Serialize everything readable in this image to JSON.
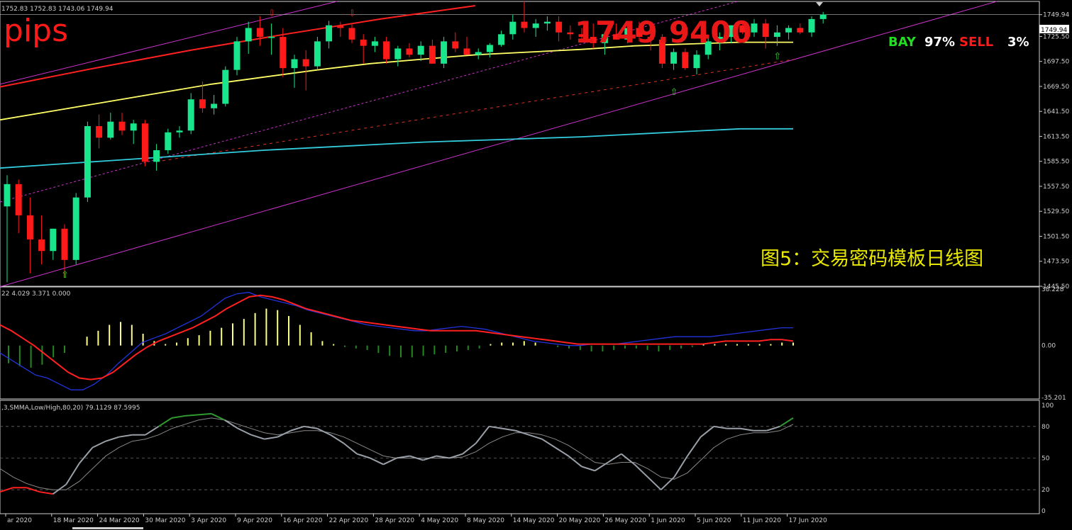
{
  "header": {
    "ohlc_text": "1752.83 1752.83 1743.06 1749.94",
    "pips_label": "pips",
    "price_big": "1749.9400",
    "bay_label": "BAY",
    "bay_pct": "97%",
    "sell_label": "SELL",
    "sell_pct": "3%",
    "caption": "图5：交易密码模板日线图",
    "current_price_tag": "1749.94"
  },
  "colors": {
    "background": "#000000",
    "bull": "#19e68c",
    "bear": "#ff1a1a",
    "ma_yellow": "#ffff66",
    "ma_cyan": "#33ccdd",
    "ma_red": "#ff2020",
    "channel": "#cc33cc",
    "macd_signal": "#ff2020",
    "macd_main": "#2233dd",
    "hist_pos": "#ffff88",
    "hist_neg": "#228822",
    "stoch_main": "#9aa0a8",
    "stoch_signal": "#888888",
    "stoch_up": "#2f9a2f",
    "stoch_down": "#ff2020"
  },
  "chart_data": [
    {
      "type": "candlestick",
      "title": "",
      "ylim": [
        1445.5,
        1760
      ],
      "y_ticks": [
        "1749.94",
        "1725.50",
        "1697.50",
        "1669.50",
        "1641.50",
        "1613.50",
        "1585.50",
        "1557.50",
        "1529.50",
        "1501.50",
        "1473.50",
        "1445.50"
      ],
      "x_labels": [
        {
          "i": 0,
          "label": "ar 2020"
        },
        {
          "i": 4,
          "label": "18 Mar 2020"
        },
        {
          "i": 8,
          "label": "24 Mar 2020"
        },
        {
          "i": 12,
          "label": "30 Mar 2020"
        },
        {
          "i": 16,
          "label": "3 Apr 2020"
        },
        {
          "i": 20,
          "label": "9 Apr 2020"
        },
        {
          "i": 24,
          "label": "16 Apr 2020"
        },
        {
          "i": 28,
          "label": "22 Apr 2020"
        },
        {
          "i": 32,
          "label": "28 Apr 2020"
        },
        {
          "i": 36,
          "label": "4 May 2020"
        },
        {
          "i": 40,
          "label": "8 May 2020"
        },
        {
          "i": 44,
          "label": "14 May 2020"
        },
        {
          "i": 48,
          "label": "20 May 2020"
        },
        {
          "i": 52,
          "label": "26 May 2020"
        },
        {
          "i": 56,
          "label": "1 Jun 2020"
        },
        {
          "i": 60,
          "label": "5 Jun 2020"
        },
        {
          "i": 64,
          "label": "11 Jun 2020"
        },
        {
          "i": 68,
          "label": "17 Jun 2020"
        }
      ],
      "candles": [
        [
          1535,
          1570,
          1450,
          1560
        ],
        [
          1560,
          1565,
          1505,
          1525
        ],
        [
          1525,
          1545,
          1460,
          1498
        ],
        [
          1498,
          1525,
          1470,
          1485
        ],
        [
          1485,
          1510,
          1475,
          1510
        ],
        [
          1510,
          1515,
          1455,
          1475
        ],
        [
          1475,
          1550,
          1470,
          1545
        ],
        [
          1545,
          1630,
          1540,
          1625
        ],
        [
          1625,
          1638,
          1600,
          1612
        ],
        [
          1612,
          1640,
          1610,
          1630
        ],
        [
          1630,
          1640,
          1615,
          1620
        ],
        [
          1620,
          1632,
          1605,
          1628
        ],
        [
          1628,
          1632,
          1580,
          1585
        ],
        [
          1585,
          1605,
          1575,
          1598
        ],
        [
          1598,
          1622,
          1594,
          1618
        ],
        [
          1618,
          1625,
          1612,
          1620
        ],
        [
          1620,
          1662,
          1616,
          1655
        ],
        [
          1655,
          1675,
          1640,
          1645
        ],
        [
          1645,
          1660,
          1638,
          1650
        ],
        [
          1650,
          1692,
          1647,
          1688
        ],
        [
          1688,
          1725,
          1682,
          1720
        ],
        [
          1720,
          1742,
          1706,
          1735
        ],
        [
          1735,
          1748,
          1715,
          1725
        ],
        [
          1725,
          1740,
          1705,
          1725
        ],
        [
          1725,
          1735,
          1680,
          1690
        ],
        [
          1690,
          1705,
          1668,
          1700
        ],
        [
          1700,
          1710,
          1665,
          1692
        ],
        [
          1692,
          1725,
          1688,
          1720
        ],
        [
          1720,
          1743,
          1712,
          1738
        ],
        [
          1738,
          1742,
          1725,
          1735
        ],
        [
          1735,
          1740,
          1718,
          1722
        ],
        [
          1722,
          1728,
          1695,
          1715
        ],
        [
          1715,
          1725,
          1708,
          1720
        ],
        [
          1720,
          1725,
          1695,
          1700
        ],
        [
          1700,
          1715,
          1692,
          1712
        ],
        [
          1712,
          1718,
          1702,
          1705
        ],
        [
          1705,
          1720,
          1698,
          1715
        ],
        [
          1715,
          1722,
          1702,
          1695
        ],
        [
          1695,
          1725,
          1690,
          1720
        ],
        [
          1720,
          1730,
          1708,
          1712
        ],
        [
          1712,
          1725,
          1705,
          1705
        ],
        [
          1705,
          1712,
          1700,
          1708
        ],
        [
          1708,
          1718,
          1702,
          1716
        ],
        [
          1716,
          1732,
          1714,
          1728
        ],
        [
          1728,
          1750,
          1722,
          1742
        ],
        [
          1742,
          1765,
          1730,
          1735
        ],
        [
          1735,
          1745,
          1725,
          1740
        ],
        [
          1740,
          1748,
          1732,
          1742
        ],
        [
          1742,
          1748,
          1720,
          1730
        ],
        [
          1730,
          1738,
          1722,
          1728
        ],
        [
          1728,
          1735,
          1720,
          1725
        ],
        [
          1725,
          1740,
          1712,
          1718
        ],
        [
          1718,
          1730,
          1705,
          1728
        ],
        [
          1728,
          1740,
          1722,
          1722
        ],
        [
          1722,
          1738,
          1718,
          1735
        ],
        [
          1735,
          1742,
          1720,
          1725
        ],
        [
          1725,
          1728,
          1710,
          1722
        ],
        [
          1722,
          1728,
          1690,
          1695
        ],
        [
          1695,
          1712,
          1688,
          1708
        ],
        [
          1708,
          1712,
          1688,
          1690
        ],
        [
          1690,
          1710,
          1683,
          1705
        ],
        [
          1705,
          1725,
          1700,
          1720
        ],
        [
          1720,
          1730,
          1710,
          1725
        ],
        [
          1725,
          1738,
          1718,
          1738
        ],
        [
          1738,
          1742,
          1728,
          1730
        ],
        [
          1730,
          1745,
          1725,
          1740
        ],
        [
          1740,
          1745,
          1712,
          1725
        ],
        [
          1725,
          1738,
          1715,
          1730
        ],
        [
          1730,
          1738,
          1722,
          1735
        ],
        [
          1735,
          1740,
          1728,
          1730
        ],
        [
          1730,
          1748,
          1725,
          1745
        ],
        [
          1745,
          1753,
          1740,
          1750
        ]
      ],
      "ma_slow_yellow": [
        1632,
        1642,
        1652,
        1662,
        1672,
        1680,
        1688,
        1695,
        1700,
        1705,
        1708,
        1711,
        1715,
        1717,
        1719,
        1719
      ],
      "ma_slow_cyan": [
        1578,
        1582,
        1586,
        1590,
        1594,
        1598,
        1601,
        1604,
        1607,
        1609,
        1611,
        1613,
        1616,
        1619,
        1622,
        1622
      ],
      "ma_slow_red_upper": [
        1669,
        1690,
        1710,
        1728,
        1745,
        1760
      ]
    },
    {
      "type": "line",
      "title": "MACD",
      "label_text": "22 4.029 3.371 0.000",
      "ylim": [
        -35.201,
        38.228
      ],
      "y_ticks": [
        "38.228",
        "0.00",
        "-35.201"
      ],
      "histogram": [
        -12,
        -14,
        -15,
        -13,
        -8,
        -5,
        0,
        6,
        10,
        14,
        16,
        14,
        8,
        3,
        1,
        2,
        5,
        7,
        10,
        12,
        15,
        18,
        22,
        25,
        24,
        20,
        14,
        9,
        3,
        1,
        -1,
        -2,
        -3,
        -5,
        -7,
        -8,
        -8,
        -7,
        -6,
        -5,
        -4,
        -3,
        -2,
        1,
        2,
        2,
        3,
        2,
        0,
        -1,
        -2,
        -3,
        -4,
        -4,
        -3,
        -2,
        -2,
        -3,
        -4,
        -3,
        -2,
        -1,
        1,
        1,
        1,
        1,
        1,
        1,
        1,
        2,
        2
      ],
      "signal": [
        14,
        10,
        5,
        0,
        -6,
        -12,
        -18,
        -22,
        -23,
        -22,
        -18,
        -12,
        -6,
        -1,
        3,
        6,
        9,
        12,
        16,
        20,
        25,
        29,
        33,
        34,
        33,
        31,
        28,
        25,
        23,
        21,
        19,
        17,
        16,
        15,
        14,
        13,
        12,
        11,
        10,
        10,
        10,
        10,
        10,
        9,
        8,
        7,
        6,
        5,
        4,
        3,
        2,
        1,
        1,
        1,
        1,
        1,
        1,
        1,
        1,
        1,
        1,
        1,
        1,
        2,
        3,
        3,
        3,
        3,
        4,
        4,
        3
      ],
      "main": [
        -5,
        -10,
        -15,
        -20,
        -22,
        -26,
        -30,
        -30,
        -26,
        -20,
        -12,
        -5,
        2,
        5,
        8,
        12,
        16,
        20,
        26,
        32,
        35,
        36,
        33,
        31,
        29,
        27,
        24,
        22,
        20,
        18,
        16,
        14,
        13,
        12,
        11,
        10,
        10,
        11,
        12,
        13,
        12,
        11,
        9,
        7,
        5,
        3,
        2,
        1,
        0,
        0,
        1,
        1,
        1,
        2,
        3,
        4,
        5,
        6,
        6,
        6,
        6,
        7,
        8,
        9,
        10,
        11,
        12,
        12
      ]
    },
    {
      "type": "line",
      "title": "Stochastic",
      "label_text": ",3,SMMA,Low/High,80,20) 79.1129 87.5995",
      "ylim": [
        0,
        100
      ],
      "y_ticks": [
        "100",
        "80",
        "50",
        "20",
        "0"
      ],
      "levels": [
        80,
        50,
        20
      ],
      "main": [
        18,
        22,
        22,
        18,
        16,
        25,
        45,
        60,
        66,
        70,
        72,
        72,
        80,
        88,
        90,
        91,
        92,
        86,
        78,
        72,
        68,
        70,
        76,
        80,
        78,
        72,
        64,
        54,
        50,
        44,
        50,
        52,
        48,
        52,
        50,
        54,
        64,
        80,
        78,
        76,
        72,
        68,
        60,
        52,
        42,
        38,
        46,
        54,
        44,
        32,
        20,
        32,
        52,
        70,
        80,
        78,
        78,
        76,
        76,
        80,
        88
      ],
      "signal": [
        40,
        32,
        26,
        22,
        20,
        20,
        28,
        40,
        52,
        60,
        66,
        68,
        72,
        78,
        82,
        86,
        88,
        86,
        82,
        78,
        74,
        72,
        74,
        76,
        76,
        74,
        70,
        64,
        58,
        52,
        50,
        50,
        50,
        50,
        50,
        51,
        56,
        64,
        70,
        74,
        74,
        72,
        68,
        62,
        54,
        46,
        44,
        46,
        46,
        40,
        32,
        30,
        36,
        48,
        60,
        68,
        72,
        74,
        74,
        76,
        82
      ]
    }
  ]
}
